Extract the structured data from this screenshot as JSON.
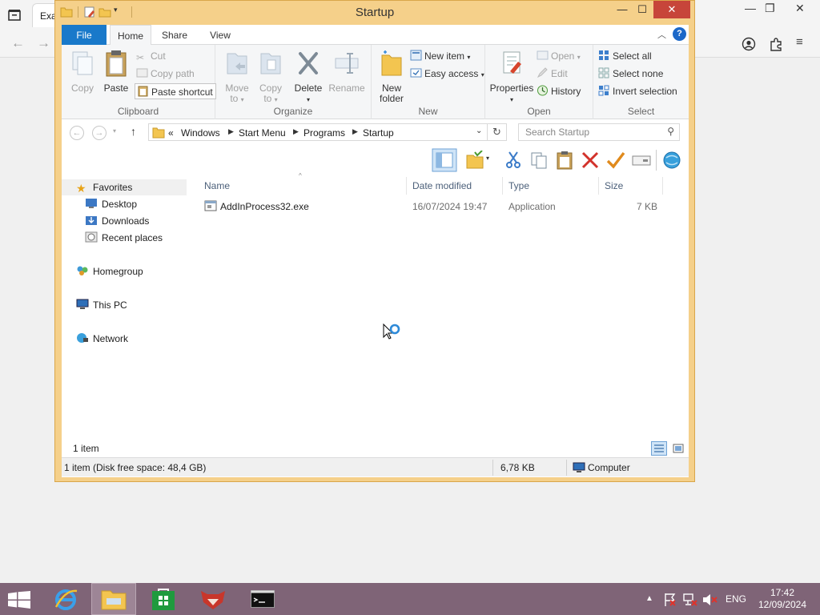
{
  "browser": {
    "tab_label": "Exa",
    "back_icon": "arrow-left-icon",
    "forward_icon": "arrow-right-icon"
  },
  "window": {
    "title": "Startup",
    "accent_color": "#f5d08a",
    "close_color": "#c7453a"
  },
  "ribbon": {
    "tabs": [
      "File",
      "Home",
      "Share",
      "View"
    ],
    "active_tab": "Home",
    "clipboard": {
      "label": "Clipboard",
      "copy": "Copy",
      "paste": "Paste",
      "cut": "Cut",
      "copy_path": "Copy path",
      "paste_shortcut": "Paste shortcut"
    },
    "organize": {
      "label": "Organize",
      "move_to_1": "Move",
      "move_to_2": "to",
      "copy_to_1": "Copy",
      "copy_to_2": "to",
      "delete": "Delete",
      "rename": "Rename"
    },
    "new": {
      "label": "New",
      "new_folder_1": "New",
      "new_folder_2": "folder",
      "new_item": "New item",
      "easy_access": "Easy access"
    },
    "open": {
      "label": "Open",
      "properties": "Properties",
      "open": "Open",
      "edit": "Edit",
      "history": "History"
    },
    "select": {
      "label": "Select",
      "select_all": "Select all",
      "select_none": "Select none",
      "invert_selection": "Invert selection"
    }
  },
  "address": {
    "overflow": "«",
    "crumbs": [
      "Windows",
      "Start Menu",
      "Programs",
      "Startup"
    ],
    "search_placeholder": "Search Startup"
  },
  "nav": {
    "favorites": "Favorites",
    "desktop": "Desktop",
    "downloads": "Downloads",
    "recent_places": "Recent places",
    "homegroup": "Homegroup",
    "this_pc": "This PC",
    "network": "Network"
  },
  "columns": {
    "name": "Name",
    "date_modified": "Date modified",
    "type": "Type",
    "size": "Size"
  },
  "files": [
    {
      "name": "AddInProcess32.exe",
      "date_modified": "16/07/2024 19:47",
      "type": "Application",
      "size": "7 KB"
    }
  ],
  "status": {
    "item_count": "1 item",
    "details": "1 item (Disk free space: 48,4 GB)",
    "selection_size": "6,78 KB",
    "location": "Computer"
  },
  "taskbar": {
    "language": "ENG",
    "time": "17:42",
    "date": "12/09/2024",
    "color": "#7f6477"
  }
}
